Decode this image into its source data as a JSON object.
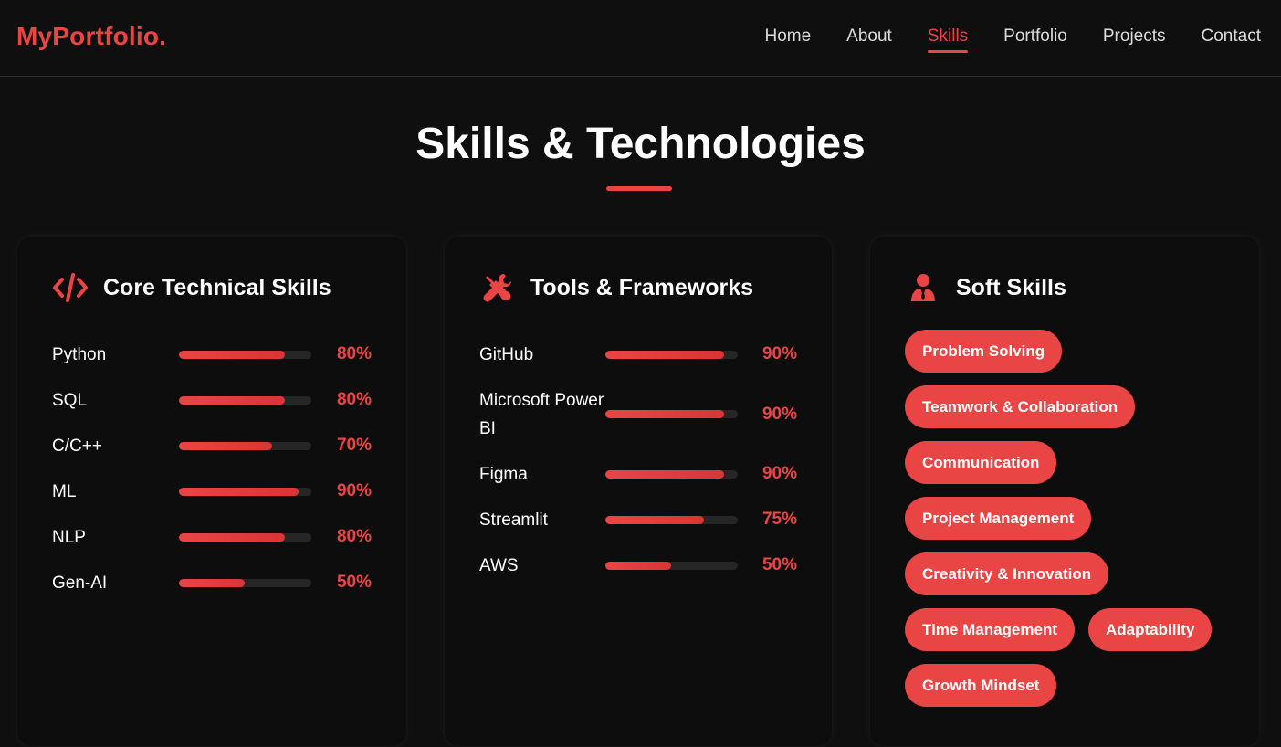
{
  "nav": {
    "logo": "MyPortfolio.",
    "links": [
      "Home",
      "About",
      "Skills",
      "Portfolio",
      "Projects",
      "Contact"
    ],
    "active": "Skills"
  },
  "section": {
    "title": "Skills & Technologies"
  },
  "core": {
    "title": "Core Technical Skills",
    "icon": "code-icon",
    "skills": [
      {
        "name": "Python",
        "percent": "80%",
        "value": 80
      },
      {
        "name": "SQL",
        "percent": "80%",
        "value": 80
      },
      {
        "name": "C/C++",
        "percent": "70%",
        "value": 70
      },
      {
        "name": "ML",
        "percent": "90%",
        "value": 90
      },
      {
        "name": "NLP",
        "percent": "80%",
        "value": 80
      },
      {
        "name": "Gen-AI",
        "percent": "50%",
        "value": 50
      }
    ]
  },
  "tools": {
    "title": "Tools & Frameworks",
    "icon": "tools-icon",
    "skills": [
      {
        "name": "GitHub",
        "percent": "90%",
        "value": 90
      },
      {
        "name": "Microsoft Power BI",
        "percent": "90%",
        "value": 90
      },
      {
        "name": "Figma",
        "percent": "90%",
        "value": 90
      },
      {
        "name": "Streamlit",
        "percent": "75%",
        "value": 75
      },
      {
        "name": "AWS",
        "percent": "50%",
        "value": 50
      }
    ]
  },
  "soft": {
    "title": "Soft Skills",
    "icon": "user-tie-icon",
    "items": [
      "Problem Solving",
      "Teamwork & Collaboration",
      "Communication",
      "Project Management",
      "Creativity & Innovation",
      "Time Management",
      "Adaptability",
      "Growth Mindset"
    ]
  },
  "colors": {
    "accent": "#e94545",
    "background": "#0f0f0f",
    "track": "#262626"
  }
}
